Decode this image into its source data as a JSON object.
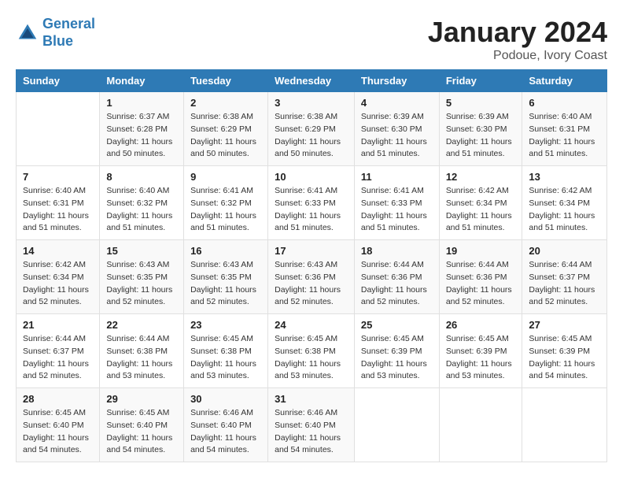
{
  "logo": {
    "line1": "General",
    "line2": "Blue"
  },
  "title": "January 2024",
  "subtitle": "Podoue, Ivory Coast",
  "days_header": [
    "Sunday",
    "Monday",
    "Tuesday",
    "Wednesday",
    "Thursday",
    "Friday",
    "Saturday"
  ],
  "weeks": [
    [
      {
        "day": "",
        "sunrise": "",
        "sunset": "",
        "daylight": ""
      },
      {
        "day": "1",
        "sunrise": "Sunrise: 6:37 AM",
        "sunset": "Sunset: 6:28 PM",
        "daylight": "Daylight: 11 hours and 50 minutes."
      },
      {
        "day": "2",
        "sunrise": "Sunrise: 6:38 AM",
        "sunset": "Sunset: 6:29 PM",
        "daylight": "Daylight: 11 hours and 50 minutes."
      },
      {
        "day": "3",
        "sunrise": "Sunrise: 6:38 AM",
        "sunset": "Sunset: 6:29 PM",
        "daylight": "Daylight: 11 hours and 50 minutes."
      },
      {
        "day": "4",
        "sunrise": "Sunrise: 6:39 AM",
        "sunset": "Sunset: 6:30 PM",
        "daylight": "Daylight: 11 hours and 51 minutes."
      },
      {
        "day": "5",
        "sunrise": "Sunrise: 6:39 AM",
        "sunset": "Sunset: 6:30 PM",
        "daylight": "Daylight: 11 hours and 51 minutes."
      },
      {
        "day": "6",
        "sunrise": "Sunrise: 6:40 AM",
        "sunset": "Sunset: 6:31 PM",
        "daylight": "Daylight: 11 hours and 51 minutes."
      }
    ],
    [
      {
        "day": "7",
        "sunrise": "Sunrise: 6:40 AM",
        "sunset": "Sunset: 6:31 PM",
        "daylight": "Daylight: 11 hours and 51 minutes."
      },
      {
        "day": "8",
        "sunrise": "Sunrise: 6:40 AM",
        "sunset": "Sunset: 6:32 PM",
        "daylight": "Daylight: 11 hours and 51 minutes."
      },
      {
        "day": "9",
        "sunrise": "Sunrise: 6:41 AM",
        "sunset": "Sunset: 6:32 PM",
        "daylight": "Daylight: 11 hours and 51 minutes."
      },
      {
        "day": "10",
        "sunrise": "Sunrise: 6:41 AM",
        "sunset": "Sunset: 6:33 PM",
        "daylight": "Daylight: 11 hours and 51 minutes."
      },
      {
        "day": "11",
        "sunrise": "Sunrise: 6:41 AM",
        "sunset": "Sunset: 6:33 PM",
        "daylight": "Daylight: 11 hours and 51 minutes."
      },
      {
        "day": "12",
        "sunrise": "Sunrise: 6:42 AM",
        "sunset": "Sunset: 6:34 PM",
        "daylight": "Daylight: 11 hours and 51 minutes."
      },
      {
        "day": "13",
        "sunrise": "Sunrise: 6:42 AM",
        "sunset": "Sunset: 6:34 PM",
        "daylight": "Daylight: 11 hours and 51 minutes."
      }
    ],
    [
      {
        "day": "14",
        "sunrise": "Sunrise: 6:42 AM",
        "sunset": "Sunset: 6:34 PM",
        "daylight": "Daylight: 11 hours and 52 minutes."
      },
      {
        "day": "15",
        "sunrise": "Sunrise: 6:43 AM",
        "sunset": "Sunset: 6:35 PM",
        "daylight": "Daylight: 11 hours and 52 minutes."
      },
      {
        "day": "16",
        "sunrise": "Sunrise: 6:43 AM",
        "sunset": "Sunset: 6:35 PM",
        "daylight": "Daylight: 11 hours and 52 minutes."
      },
      {
        "day": "17",
        "sunrise": "Sunrise: 6:43 AM",
        "sunset": "Sunset: 6:36 PM",
        "daylight": "Daylight: 11 hours and 52 minutes."
      },
      {
        "day": "18",
        "sunrise": "Sunrise: 6:44 AM",
        "sunset": "Sunset: 6:36 PM",
        "daylight": "Daylight: 11 hours and 52 minutes."
      },
      {
        "day": "19",
        "sunrise": "Sunrise: 6:44 AM",
        "sunset": "Sunset: 6:36 PM",
        "daylight": "Daylight: 11 hours and 52 minutes."
      },
      {
        "day": "20",
        "sunrise": "Sunrise: 6:44 AM",
        "sunset": "Sunset: 6:37 PM",
        "daylight": "Daylight: 11 hours and 52 minutes."
      }
    ],
    [
      {
        "day": "21",
        "sunrise": "Sunrise: 6:44 AM",
        "sunset": "Sunset: 6:37 PM",
        "daylight": "Daylight: 11 hours and 52 minutes."
      },
      {
        "day": "22",
        "sunrise": "Sunrise: 6:44 AM",
        "sunset": "Sunset: 6:38 PM",
        "daylight": "Daylight: 11 hours and 53 minutes."
      },
      {
        "day": "23",
        "sunrise": "Sunrise: 6:45 AM",
        "sunset": "Sunset: 6:38 PM",
        "daylight": "Daylight: 11 hours and 53 minutes."
      },
      {
        "day": "24",
        "sunrise": "Sunrise: 6:45 AM",
        "sunset": "Sunset: 6:38 PM",
        "daylight": "Daylight: 11 hours and 53 minutes."
      },
      {
        "day": "25",
        "sunrise": "Sunrise: 6:45 AM",
        "sunset": "Sunset: 6:39 PM",
        "daylight": "Daylight: 11 hours and 53 minutes."
      },
      {
        "day": "26",
        "sunrise": "Sunrise: 6:45 AM",
        "sunset": "Sunset: 6:39 PM",
        "daylight": "Daylight: 11 hours and 53 minutes."
      },
      {
        "day": "27",
        "sunrise": "Sunrise: 6:45 AM",
        "sunset": "Sunset: 6:39 PM",
        "daylight": "Daylight: 11 hours and 54 minutes."
      }
    ],
    [
      {
        "day": "28",
        "sunrise": "Sunrise: 6:45 AM",
        "sunset": "Sunset: 6:40 PM",
        "daylight": "Daylight: 11 hours and 54 minutes."
      },
      {
        "day": "29",
        "sunrise": "Sunrise: 6:45 AM",
        "sunset": "Sunset: 6:40 PM",
        "daylight": "Daylight: 11 hours and 54 minutes."
      },
      {
        "day": "30",
        "sunrise": "Sunrise: 6:46 AM",
        "sunset": "Sunset: 6:40 PM",
        "daylight": "Daylight: 11 hours and 54 minutes."
      },
      {
        "day": "31",
        "sunrise": "Sunrise: 6:46 AM",
        "sunset": "Sunset: 6:40 PM",
        "daylight": "Daylight: 11 hours and 54 minutes."
      },
      {
        "day": "",
        "sunrise": "",
        "sunset": "",
        "daylight": ""
      },
      {
        "day": "",
        "sunrise": "",
        "sunset": "",
        "daylight": ""
      },
      {
        "day": "",
        "sunrise": "",
        "sunset": "",
        "daylight": ""
      }
    ]
  ]
}
